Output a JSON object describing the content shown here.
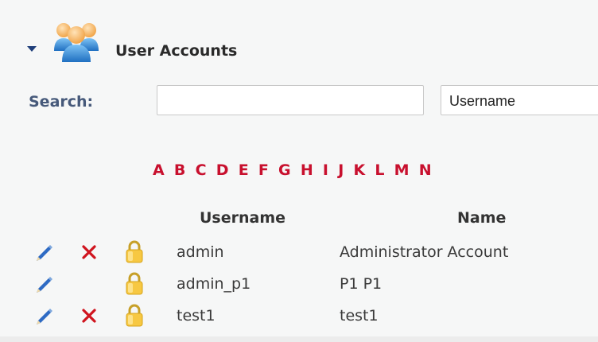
{
  "panel": {
    "title": "User Accounts",
    "icon": "users-icon"
  },
  "search": {
    "label": "Search:",
    "value": "",
    "placeholder": "",
    "field_selected": "Username"
  },
  "alphabet": [
    "A",
    "B",
    "C",
    "D",
    "E",
    "F",
    "G",
    "H",
    "I",
    "J",
    "K",
    "L",
    "M",
    "N"
  ],
  "table": {
    "columns": [
      "Username",
      "Name"
    ],
    "rows": [
      {
        "username": "admin",
        "name": "Administrator Account",
        "deletable": true
      },
      {
        "username": "admin_p1",
        "name": "P1 P1",
        "deletable": false
      },
      {
        "username": "test1",
        "name": "test1",
        "deletable": true
      }
    ]
  },
  "colors": {
    "accent_red": "#c8102e",
    "label_blue": "#46597a",
    "caret_blue": "#1f3f7a"
  }
}
